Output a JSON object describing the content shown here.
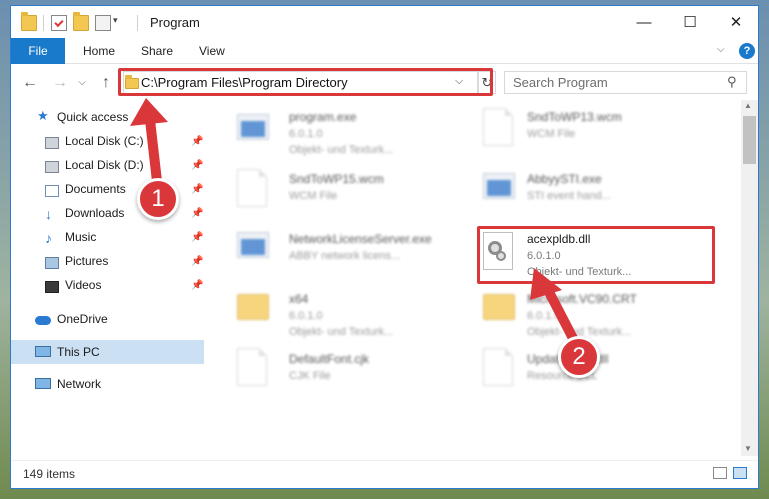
{
  "window": {
    "title": "Program",
    "controls": {
      "minimize": "—",
      "maximize": "☐",
      "close": "✕"
    }
  },
  "ribbon": {
    "tabs": [
      "File",
      "Home",
      "Share",
      "View"
    ],
    "help": "?"
  },
  "address": {
    "path": "C:\\Program Files\\Program Directory",
    "search_placeholder": "Search Program"
  },
  "nav": {
    "quick_access": "Quick access",
    "items": [
      {
        "label": "Local Disk (C:)",
        "icon": "drive-icon"
      },
      {
        "label": "Local Disk (D:)",
        "icon": "drive-icon"
      },
      {
        "label": "Documents",
        "icon": "documents-icon"
      },
      {
        "label": "Downloads",
        "icon": "downloads-icon"
      },
      {
        "label": "Music",
        "icon": "music-icon"
      },
      {
        "label": "Pictures",
        "icon": "pictures-icon"
      },
      {
        "label": "Videos",
        "icon": "videos-icon"
      }
    ],
    "onedrive": "OneDrive",
    "this_pc": "This PC",
    "network": "Network"
  },
  "files": [
    {
      "name": "program.exe",
      "line1": "6.0.1.0",
      "line2": "Objekt- und Texturk..."
    },
    {
      "name": "SndToWP13.wcm",
      "line1": "WCM File",
      "line2": ""
    },
    {
      "name": "SndToWP15.wcm",
      "line1": "WCM File",
      "line2": ""
    },
    {
      "name": "AbbyySTI.exe",
      "line1": "STI event hand...",
      "line2": ""
    },
    {
      "name": "NetworkLicenseServer.exe",
      "line1": "ABBY network licens...",
      "line2": ""
    },
    {
      "name": "acexpldb.dll",
      "line1": "6.0.1.0",
      "line2": "Objekt- und Texturk..."
    },
    {
      "name": "x64",
      "line1": "6.0.1.0",
      "line2": "Objekt- und Texturk..."
    },
    {
      "name": "Microsoft.VC90.CRT",
      "line1": "6.0.1.0",
      "line2": "Objekt- und Texturk..."
    },
    {
      "name": "DefaultFont.cjk",
      "line1": "CJK File",
      "line2": ""
    },
    {
      "name": "UpdateDll42.dll",
      "line1": "Resource DLL",
      "line2": ""
    }
  ],
  "status": {
    "count": "149 items"
  },
  "annotations": {
    "step1": "1",
    "step2": "2"
  },
  "colors": {
    "accent": "#1979ca",
    "annotation": "#d9373a",
    "selection": "#cce0f4"
  }
}
